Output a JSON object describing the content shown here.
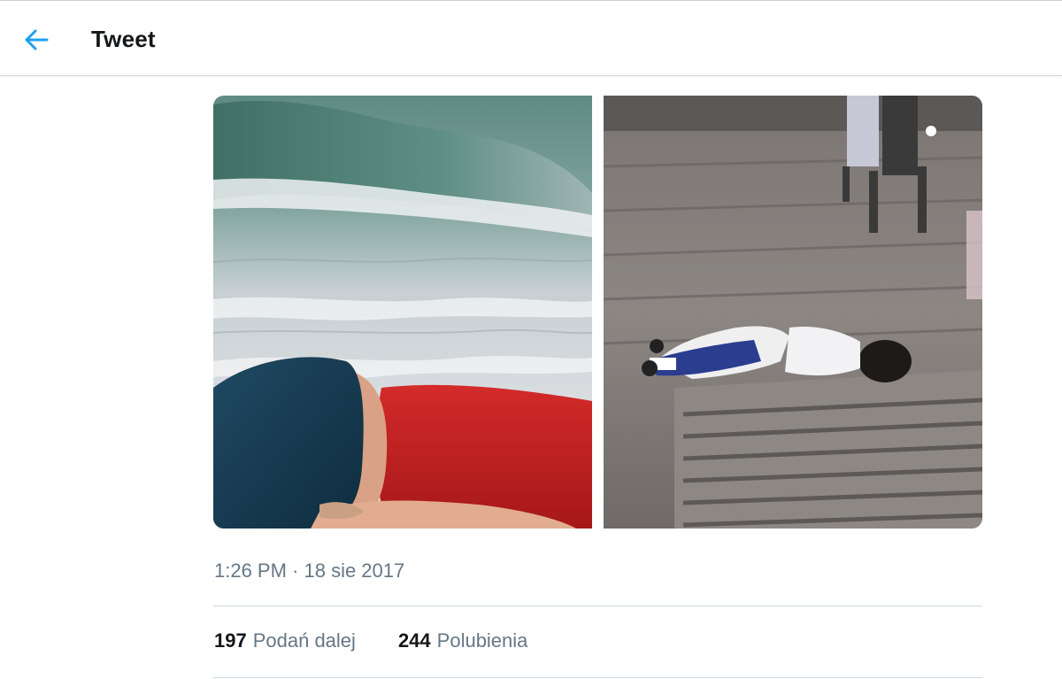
{
  "header": {
    "title": "Tweet",
    "back_icon": "arrow-left-icon",
    "accent_color": "#1da1f2"
  },
  "media": {
    "images": [
      {
        "name": "beach-photo"
      },
      {
        "name": "street-photo"
      }
    ]
  },
  "tweet": {
    "timestamp": "1:26 PM · 18 sie 2017",
    "retweets_count": "197",
    "retweets_label": "Podań dalej",
    "likes_count": "244",
    "likes_label": "Polubienia"
  },
  "colors": {
    "text_primary": "#14171a",
    "text_secondary": "#657786",
    "divider": "#cfd9de"
  }
}
